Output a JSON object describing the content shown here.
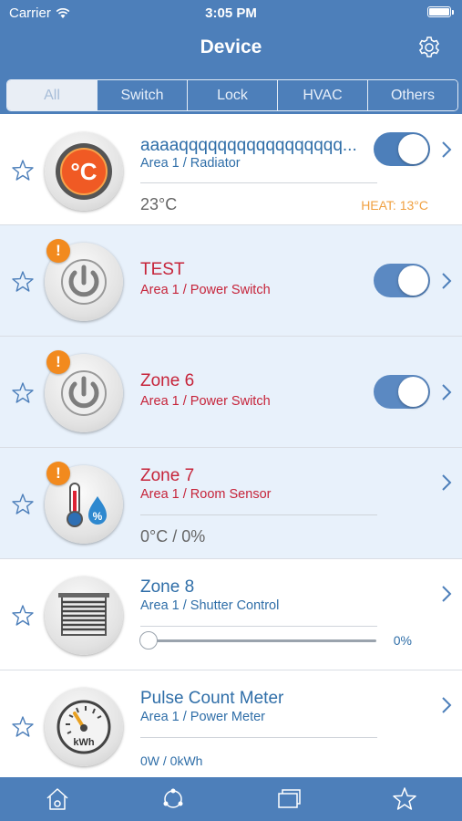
{
  "status": {
    "carrier": "Carrier",
    "time": "3:05 PM"
  },
  "nav": {
    "title": "Device"
  },
  "filters": [
    "All",
    "Switch",
    "Lock",
    "HVAC",
    "Others"
  ],
  "devices": [
    {
      "name": "aaaaqqqqqqqqqqqqqqqqq...",
      "location": "Area 1 / Radiator",
      "reading": "23°C",
      "heat": "HEAT: 13°C",
      "switch_on": true,
      "icon": "thermostat-icon"
    },
    {
      "name": "TEST",
      "location": "Area 1 / Power Switch",
      "switch_on": true,
      "icon": "power-icon",
      "warning": "!"
    },
    {
      "name": "Zone 6",
      "location": "Area 1 / Power Switch",
      "switch_on": true,
      "icon": "power-icon",
      "warning": "!"
    },
    {
      "name": "Zone 7",
      "location": "Area 1 / Room Sensor",
      "reading": "0°C / 0%",
      "icon": "room-sensor-icon",
      "warning": "!"
    },
    {
      "name": "Zone 8",
      "location": "Area 1 / Shutter Control",
      "position_pct": "0%",
      "position": 0,
      "icon": "shutter-icon"
    },
    {
      "name": "Pulse Count Meter",
      "location": "Area 1 / Power Meter",
      "reading": "0W / 0kWh",
      "icon": "power-meter-icon"
    }
  ],
  "tabs": [
    "home-icon",
    "scenes-icon",
    "rooms-icon",
    "favorites-icon"
  ],
  "colors": {
    "brand": "#4d7fba",
    "alert_row": "#e8f1fb",
    "warning": "#f28a1e",
    "error_text": "#c6243a"
  }
}
